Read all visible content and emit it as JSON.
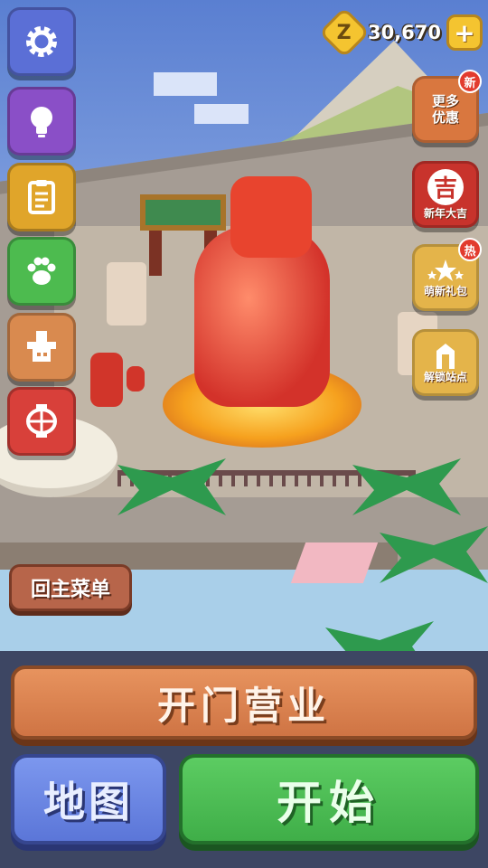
{
  "hud": {
    "coins": "30,670",
    "coin_symbol": "Z",
    "plus_symbol": "+"
  },
  "left_menu": [
    {
      "icon": "gear-icon",
      "color": "#5b6fd6"
    },
    {
      "icon": "lightbulb-icon",
      "color": "#8a4fc7"
    },
    {
      "icon": "clipboard-icon",
      "color": "#e0a52a"
    },
    {
      "icon": "paw-icon",
      "color": "#4dbb4f"
    },
    {
      "icon": "chef-hat-icon",
      "color": "#d98a4f"
    },
    {
      "icon": "lantern-icon",
      "color": "#d8403a"
    }
  ],
  "right_menu": [
    {
      "label": "更多\n优惠",
      "badge": "新",
      "color": "#d9773f"
    },
    {
      "label": "新年大吉",
      "badge": "",
      "color": "#c8332c",
      "emblem": "吉"
    },
    {
      "label": "萌新礼包",
      "badge": "热",
      "color": "#e4b44a"
    },
    {
      "label": "解锁站点",
      "badge": "",
      "color": "#e4b44a"
    }
  ],
  "buttons": {
    "main_menu": "回主菜单",
    "open_business": "开门营业",
    "map": "地图",
    "start": "开始"
  }
}
